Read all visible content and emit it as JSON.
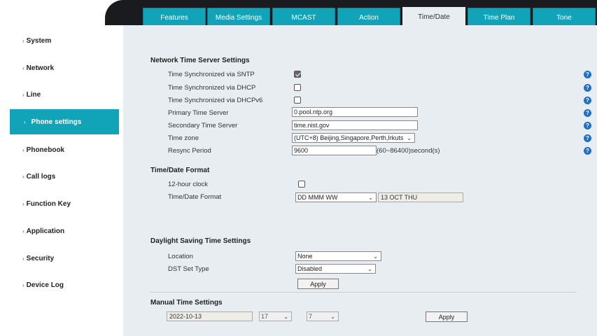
{
  "sidebar": {
    "items": [
      {
        "label": "System"
      },
      {
        "label": "Network"
      },
      {
        "label": "Line"
      },
      {
        "label": "Phone settings"
      },
      {
        "label": "Phonebook"
      },
      {
        "label": "Call logs"
      },
      {
        "label": "Function Key"
      },
      {
        "label": "Application"
      },
      {
        "label": "Security"
      },
      {
        "label": "Device Log"
      }
    ],
    "chevron": "›"
  },
  "tabs": [
    {
      "label": "Features"
    },
    {
      "label": "Media Settings"
    },
    {
      "label": "MCAST"
    },
    {
      "label": "Action"
    },
    {
      "label": "Time/Date"
    },
    {
      "label": "Time Plan"
    },
    {
      "label": "Tone"
    }
  ],
  "network_time": {
    "title": "Network Time Server Settings",
    "sntp_label": "Time Synchronized via SNTP",
    "sntp_checked": true,
    "dhcp_label": "Time Synchronized via DHCP",
    "dhcp_checked": false,
    "dhcpv6_label": "Time Synchronized via DHCPv6",
    "dhcpv6_checked": false,
    "primary_label": "Primary Time Server",
    "primary_value": "0.pool.ntp.org",
    "secondary_label": "Secondary Time Server",
    "secondary_value": "time.nist.gov",
    "timezone_label": "Time zone",
    "timezone_value": "(UTC+8) Beijing,Singapore,Perth,Irkuts",
    "resync_label": "Resync Period",
    "resync_value": "9600",
    "resync_suffix": "(60~86400)second(s)",
    "help_glyph": "?"
  },
  "time_format": {
    "title": "Time/Date Format",
    "clock12_label": "12-hour clock",
    "clock12_checked": false,
    "format_label": "Time/Date Format",
    "format_value": "DD MMM WW",
    "preview_value": "13 OCT THU"
  },
  "dst": {
    "title": "Daylight Saving Time Settings",
    "location_label": "Location",
    "location_value": "None",
    "type_label": "DST Set Type",
    "type_value": "Disabled",
    "apply_label": "Apply"
  },
  "manual": {
    "title": "Manual Time Settings",
    "date_value": "2022-10-13",
    "hour_value": "17",
    "minute_value": "7",
    "apply_label": "Apply"
  },
  "icons": {
    "dropdown_arrow": "⌄"
  }
}
